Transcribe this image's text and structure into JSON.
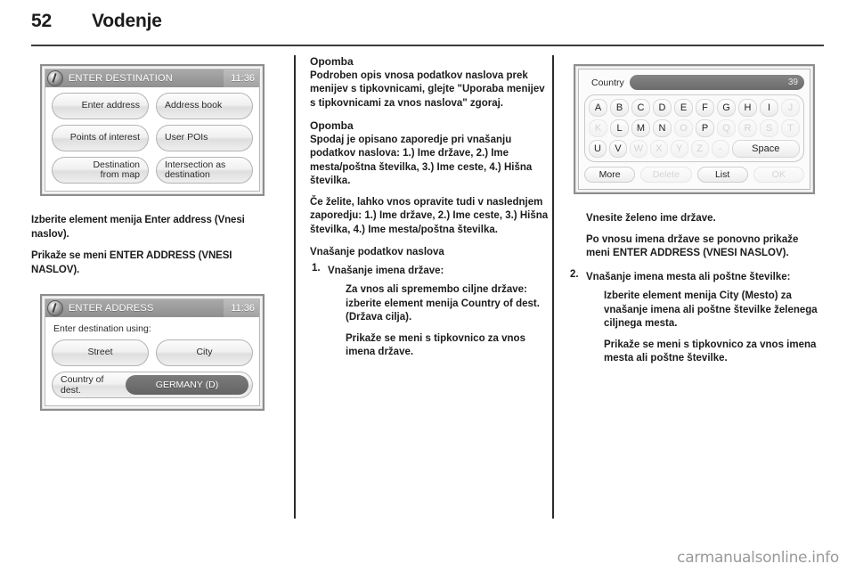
{
  "header": {
    "page_number": "52",
    "chapter": "Vodenje"
  },
  "figures": {
    "enter_destination": {
      "title": "ENTER DESTINATION",
      "clock": "11:36",
      "icon": "info-icon",
      "buttons": [
        {
          "left": "Enter address",
          "right": "Address book"
        },
        {
          "left": "Points of interest",
          "right": "User POIs"
        },
        {
          "left": "Destination\nfrom map",
          "right": "Intersection as\ndestination"
        }
      ]
    },
    "enter_address": {
      "title": "ENTER ADDRESS",
      "clock": "11:36",
      "icon": "info-icon",
      "prompt": "Enter destination using:",
      "buttons": [
        {
          "left": "Street",
          "right": "City"
        }
      ],
      "field_label": "Country of dest.",
      "field_value": "GERMANY (D)"
    },
    "country_keyboard": {
      "input_label": "Country",
      "input_count": "39",
      "rows": [
        [
          {
            "label": "A",
            "enabled": true
          },
          {
            "label": "B",
            "enabled": true
          },
          {
            "label": "C",
            "enabled": true
          },
          {
            "label": "D",
            "enabled": true
          },
          {
            "label": "E",
            "enabled": true
          },
          {
            "label": "F",
            "enabled": true
          },
          {
            "label": "G",
            "enabled": true
          },
          {
            "label": "H",
            "enabled": true
          },
          {
            "label": "I",
            "enabled": true
          },
          {
            "label": "J",
            "enabled": false
          }
        ],
        [
          {
            "label": "K",
            "enabled": false
          },
          {
            "label": "L",
            "enabled": true
          },
          {
            "label": "M",
            "enabled": true
          },
          {
            "label": "N",
            "enabled": true
          },
          {
            "label": "O",
            "enabled": false
          },
          {
            "label": "P",
            "enabled": true
          },
          {
            "label": "Q",
            "enabled": false
          },
          {
            "label": "R",
            "enabled": false
          },
          {
            "label": "S",
            "enabled": false
          },
          {
            "label": "T",
            "enabled": false
          }
        ],
        [
          {
            "label": "U",
            "enabled": true
          },
          {
            "label": "V",
            "enabled": true
          },
          {
            "label": "W",
            "enabled": false
          },
          {
            "label": "X",
            "enabled": false
          },
          {
            "label": "Y",
            "enabled": false
          },
          {
            "label": "Z",
            "enabled": false
          },
          {
            "label": "-",
            "enabled": false
          },
          {
            "label": "Space",
            "enabled": true,
            "wide": true
          }
        ]
      ],
      "actions": [
        {
          "label": "More",
          "enabled": true
        },
        {
          "label": "Delete",
          "enabled": false
        },
        {
          "label": "List",
          "enabled": true
        },
        {
          "label": "OK",
          "enabled": false
        }
      ]
    }
  },
  "column1": {
    "para1": "Izberite element menija Enter address (Vnesi naslov).",
    "para2": "Prikaže se meni ENTER ADDRESS (VNESI NASLOV)."
  },
  "column2": {
    "note1_title": "Opomba",
    "note1_body": "Podroben opis vnosa podatkov naslova prek menijev s tipkovnicami, glejte \"Uporaba menijev s tipkovnicami za vnos naslova\" zgoraj.",
    "note2_title": "Opomba",
    "note2_body": "Spodaj je opisano zaporedje pri vnašanju podatkov naslova: 1.) Ime države, 2.) Ime mesta/poštna številka, 3.) Ime ceste, 4.) Hišna številka.",
    "note2_body2": "Če želite, lahko vnos opravite tudi v naslednjem zaporedju: 1.) Ime države, 2.) Ime ceste, 3.) Hišna številka, 4.) Ime mesta/poštna številka.",
    "section_head": "Vnašanje podatkov naslova",
    "item1_num": "1.",
    "item1_text": "Vnašanje imena države:",
    "item1_sub1": "Za vnos ali spremembo ciljne države: izberite element menija Country of dest. (Država cilja).",
    "item1_sub2": "Prikaže se meni s tipkovnico za vnos imena države."
  },
  "column3": {
    "para1": "Vnesite želeno ime države.",
    "para2": "Po vnosu imena države se ponovno prikaže meni ENTER ADDRESS (VNESI NASLOV).",
    "item2_num": "2.",
    "item2_text": "Vnašanje imena mesta ali poštne številke:",
    "item2_sub1": "Izberite element menija City (Mesto) za vnašanje imena ali poštne številke želenega ciljnega mesta.",
    "item2_sub2": "Prikaže se meni s tipkovnico za vnos imena mesta ali poštne številke."
  },
  "watermark": "carmanualsonline.info"
}
